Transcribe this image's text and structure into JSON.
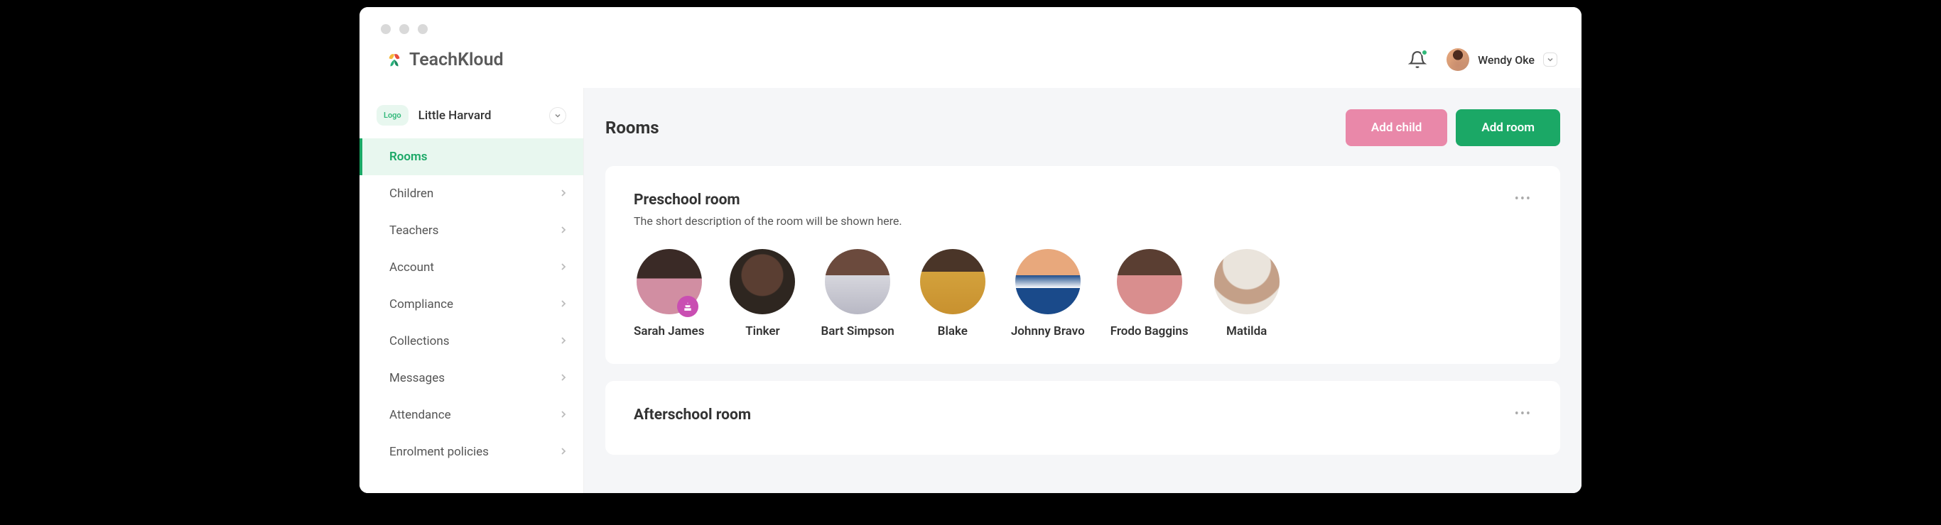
{
  "brand": "TeachKloud",
  "user": {
    "name": "Wendy Oke"
  },
  "school": {
    "logo_label": "Logo",
    "name": "Little Harvard"
  },
  "sidebar": {
    "items": [
      {
        "label": "Rooms",
        "active": true,
        "has_children": false
      },
      {
        "label": "Children",
        "active": false,
        "has_children": true
      },
      {
        "label": "Teachers",
        "active": false,
        "has_children": true
      },
      {
        "label": "Account",
        "active": false,
        "has_children": true
      },
      {
        "label": "Compliance",
        "active": false,
        "has_children": true
      },
      {
        "label": "Collections",
        "active": false,
        "has_children": true
      },
      {
        "label": "Messages",
        "active": false,
        "has_children": true
      },
      {
        "label": "Attendance",
        "active": false,
        "has_children": true
      },
      {
        "label": "Enrolment policies",
        "active": false,
        "has_children": true
      }
    ]
  },
  "page": {
    "title": "Rooms",
    "add_child_label": "Add child",
    "add_room_label": "Add room"
  },
  "rooms": [
    {
      "title": "Preschool room",
      "description": "The short description of the room will be shown here.",
      "children": [
        {
          "name": "Sarah James",
          "avatar_class": "av1",
          "has_birthday": true
        },
        {
          "name": "Tinker",
          "avatar_class": "av2",
          "has_birthday": false
        },
        {
          "name": "Bart Simpson",
          "avatar_class": "av3",
          "has_birthday": false
        },
        {
          "name": "Blake",
          "avatar_class": "av4",
          "has_birthday": false
        },
        {
          "name": "Johnny Bravo",
          "avatar_class": "av5",
          "has_birthday": false
        },
        {
          "name": "Frodo Baggins",
          "avatar_class": "av6",
          "has_birthday": false
        },
        {
          "name": "Matilda",
          "avatar_class": "av7",
          "has_birthday": false
        }
      ]
    },
    {
      "title": "Afterschool room",
      "description": "",
      "children": []
    }
  ]
}
